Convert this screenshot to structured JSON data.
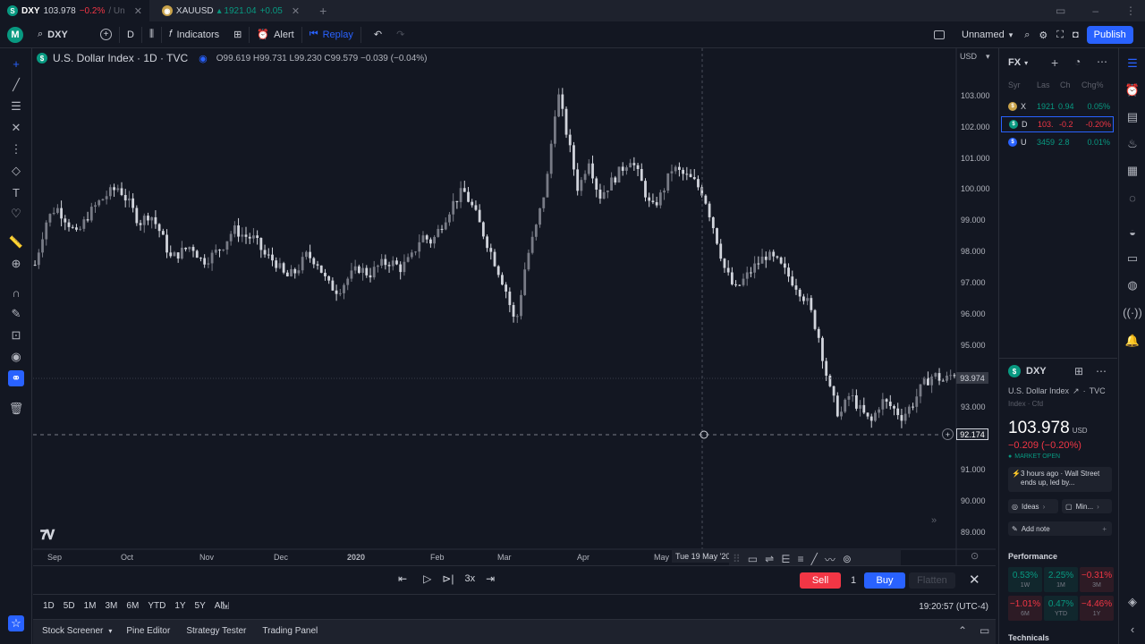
{
  "tabs": [
    {
      "icon": "S",
      "icon_color": "#089981",
      "symbol": "DXY",
      "price": "103.978",
      "change": "−0.2%",
      "extra": "/ Un",
      "close": "✕"
    },
    {
      "icon": "◉",
      "icon_color": "#c8a24a",
      "symbol": "XAUUSD",
      "price": "▴ 1921.04",
      "change": "+0.05",
      "extra": "",
      "close": "✕"
    }
  ],
  "new_tab": "+",
  "toolbar": {
    "avatar": "M",
    "symbol": "DXY",
    "interval": "D",
    "indicators": "Indicators",
    "alert": "Alert",
    "replay": "Replay",
    "layout_name": "Unnamed",
    "publish": "Publish"
  },
  "legend": {
    "title": "U.S. Dollar Index · 1D · TVC",
    "ohlc": "O99.619 H99.731 L99.230 C99.579 −0.039 (−0.04%)",
    "currency": "USD"
  },
  "price_axis": [
    "103.000",
    "102.000",
    "101.000",
    "100.000",
    "99.000",
    "98.000",
    "97.000",
    "96.000",
    "95.000",
    "93.000",
    "91.000",
    "90.000",
    "89.000"
  ],
  "price_markers": {
    "last": "93.974",
    "crosshair": "92.174"
  },
  "time_axis": [
    "Sep",
    "Oct",
    "Nov",
    "Dec",
    "2020",
    "Feb",
    "Mar",
    "Apr",
    "May"
  ],
  "crosshair_date": "Tue 19 May '20",
  "chart_data": {
    "type": "candlestick",
    "symbol": "U.S. Dollar Index",
    "timeframe": "1D",
    "ylim": [
      88.5,
      104
    ],
    "closes": [
      97.3,
      98.6,
      99.1,
      98.7,
      98.2,
      98.8,
      99.2,
      99.5,
      99.7,
      99.2,
      98.6,
      98.9,
      98.3,
      97.5,
      97.7,
      97.9,
      97.4,
      97.6,
      97.9,
      98.4,
      98.2,
      98.1,
      97.6,
      97.4,
      96.9,
      97.1,
      97.6,
      97.4,
      96.7,
      96.5,
      96.9,
      97.2,
      97.0,
      97.3,
      97.4,
      97.2,
      97.5,
      98.2,
      98.0,
      98.6,
      99.2,
      99.6,
      99.0,
      98.2,
      97.4,
      96.6,
      95.4,
      97.4,
      98.5,
      99.9,
      102.7,
      101.2,
      99.6,
      100.6,
      99.4,
      99.8,
      100.2,
      100.6,
      99.9,
      99.0,
      99.5,
      100.3,
      100.1,
      99.9,
      99.5,
      98.4,
      97.2,
      96.5,
      96.9,
      97.3,
      97.6,
      97.4,
      97.0,
      96.6,
      96.1,
      95.1,
      93.5,
      92.6,
      93.3,
      92.8,
      92.4,
      93.1,
      92.9,
      92.6,
      93.0,
      93.6,
      93.9,
      93.7,
      93.97
    ]
  },
  "watchlist": {
    "title": "FX",
    "columns": [
      "Syr",
      "Las",
      "Ch",
      "Chg%"
    ],
    "rows": [
      {
        "icon_color": "#c8a24a",
        "sym": "X",
        "last": "1921",
        "ch": "0.94",
        "chp": "0.05%",
        "dir": "pos"
      },
      {
        "icon_color": "#089981",
        "sym": "D",
        "last": "103.",
        "ch": "-0.2",
        "chp": "-0.20%",
        "dir": "neg"
      },
      {
        "icon_color": "#2962ff",
        "sym": "U",
        "last": "3459",
        "ch": "2.8",
        "chp": "0.01%",
        "dir": "pos"
      }
    ]
  },
  "details": {
    "symbol": "DXY",
    "name": "U.S. Dollar Index",
    "exchange": "TVC",
    "type": "Index · Cfd",
    "price": "103.978",
    "currency": "USD",
    "change": "−0.209 (−0.20%)",
    "status": "MARKET OPEN",
    "news": "3 hours ago · Wall Street ends up, led by...",
    "ideas": "Ideas",
    "minds": "Min...",
    "add_note": "Add note",
    "performance_title": "Performance",
    "performance": [
      {
        "value": "0.53%",
        "label": "1W",
        "dir": "pos"
      },
      {
        "value": "2.25%",
        "label": "1M",
        "dir": "pos"
      },
      {
        "value": "−0.31%",
        "label": "3M",
        "dir": "neg"
      },
      {
        "value": "−1.01%",
        "label": "6M",
        "dir": "neg"
      },
      {
        "value": "0.47%",
        "label": "YTD",
        "dir": "pos"
      },
      {
        "value": "−4.46%",
        "label": "1Y",
        "dir": "neg"
      }
    ],
    "technicals": "Technicals"
  },
  "replay_bar": {
    "speed": "3x",
    "sell": "Sell",
    "qty": "1",
    "buy": "Buy",
    "flatten": "Flatten"
  },
  "ranges": [
    "1D",
    "5D",
    "1M",
    "3M",
    "6M",
    "YTD",
    "1Y",
    "5Y",
    "All"
  ],
  "clock": "19:20:57 (UTC-4)",
  "bottom_tabs": [
    "Stock Screener",
    "Pine Editor",
    "Strategy Tester",
    "Trading Panel"
  ],
  "colors": {
    "up": "#787b86",
    "down": "#d1d4dc",
    "accent": "#2962ff",
    "neg": "#f23645",
    "pos": "#089981"
  }
}
